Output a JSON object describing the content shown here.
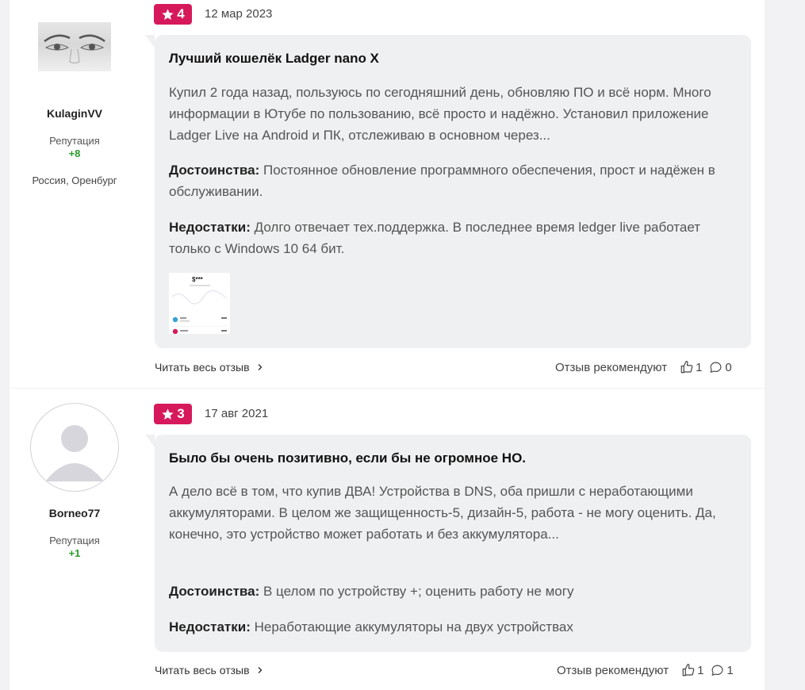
{
  "reviews": [
    {
      "author": "KulaginVV",
      "reputation_label": "Репутация",
      "reputation": "+8",
      "location": "Россия, Оренбург",
      "rating": "4",
      "date": "12 мар 2023",
      "title": "Лучший кошелёк Ladger nano X",
      "text": "Купил 2 года назад, пользуюсь по сегодняшний день, обновляю ПО и всё норм. Много информации в Ютубе по пользованию, всё просто и надёжно. Установил приложение Ladger Live на Android и ПК, отслеживаю в основном через...",
      "pros_label": "Достоинства:",
      "pros": "Постоянное обновление программного обеспечения, прост и надёжен в обслуживании.",
      "cons_label": "Недостатки:",
      "cons": "Долго отвечает тех.поддержка. В последнее время ledger live работает только с Windows 10 64 бит.",
      "read_all": "Читать весь отзыв",
      "recommend_label": "Отзыв рекомендуют",
      "likes": "1",
      "comments": "0"
    },
    {
      "author": "Borneo77",
      "reputation_label": "Репутация",
      "reputation": "+1",
      "rating": "3",
      "date": "17 авг 2021",
      "title": "Было бы очень позитивно, если бы не огромное НО.",
      "text": "А дело всё в том, что купив ДВА! Устройства в DNS, оба пришли с неработающими аккумуляторами. В целом же защищенность-5, дизайн-5, работа - не могу оценить. Да, конечно, это устройство может работать и без аккумулятора...",
      "pros_label": "Достоинства:",
      "pros": "В целом по устройству +; оценить работу не могу",
      "cons_label": "Недостатки:",
      "cons": "Неработающие аккумуляторы на двух устройствах",
      "read_all": "Читать весь отзыв",
      "recommend_label": "Отзыв рекомендуют",
      "likes": "1",
      "comments": "1"
    }
  ],
  "thumbnail": {
    "balance": "$***"
  },
  "icons": {
    "rating": "star-icon",
    "read_all": "chevron-right-icon",
    "like": "thumbs-up-icon",
    "comment": "comment-icon"
  },
  "colors": {
    "rating_badge": "#d6195a",
    "reputation": "#2a9b2a",
    "bubble": "#eff0f2",
    "page_bg": "#f2f2f4"
  }
}
